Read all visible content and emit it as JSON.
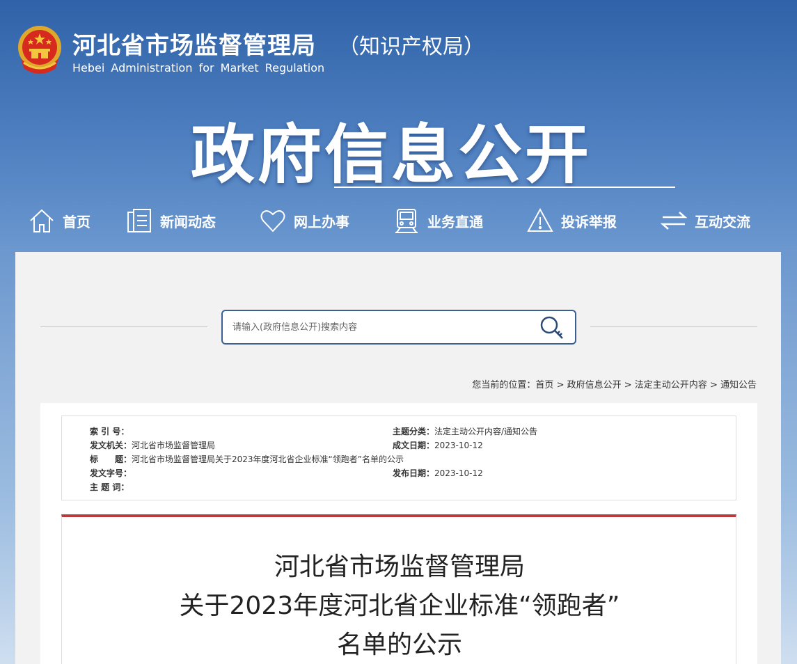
{
  "header": {
    "title": "河北省市场监督管理局",
    "subtitle": "（知识产权局）",
    "title_en": "Hebei  Administration  for  Market  Regulation",
    "banner": "政府信息公开"
  },
  "nav": [
    {
      "label": "首页",
      "icon": "home-icon"
    },
    {
      "label": "新闻动态",
      "icon": "document-icon"
    },
    {
      "label": "网上办事",
      "icon": "heart-icon"
    },
    {
      "label": "业务直通",
      "icon": "train-icon"
    },
    {
      "label": "投诉举报",
      "icon": "warning-icon"
    },
    {
      "label": "互动交流",
      "icon": "exchange-icon"
    }
  ],
  "search": {
    "placeholder": "请输入(政府信息公开)搜索内容",
    "value": ""
  },
  "breadcrumb": {
    "prefix": "您当前的位置：",
    "items": [
      "首页",
      "政府信息公开",
      "法定主动公开内容",
      "通知公告"
    ],
    "separator": " > "
  },
  "meta": {
    "index_no": {
      "key": "索 引 号：",
      "value": ""
    },
    "category": {
      "key": "主题分类：",
      "value": "法定主动公开内容/通知公告"
    },
    "issuer": {
      "key": "发文机关：",
      "value": "河北省市场监督管理局"
    },
    "created": {
      "key": "成文日期：",
      "value": "2023-10-12"
    },
    "title": {
      "key": "标　　题：",
      "value": "河北省市场监督管理局关于2023年度河北省企业标准“领跑者”名单的公示"
    },
    "doc_no": {
      "key": "发文字号：",
      "value": ""
    },
    "published": {
      "key": "发布日期：",
      "value": "2023-10-12"
    },
    "keywords": {
      "key": "主 题 词：",
      "value": ""
    }
  },
  "article": {
    "title_lines": [
      "河北省市场监督管理局",
      "关于2023年度河北省企业标准“领跑者”",
      "名单的公示"
    ],
    "accent_color": "#b83a3a"
  }
}
